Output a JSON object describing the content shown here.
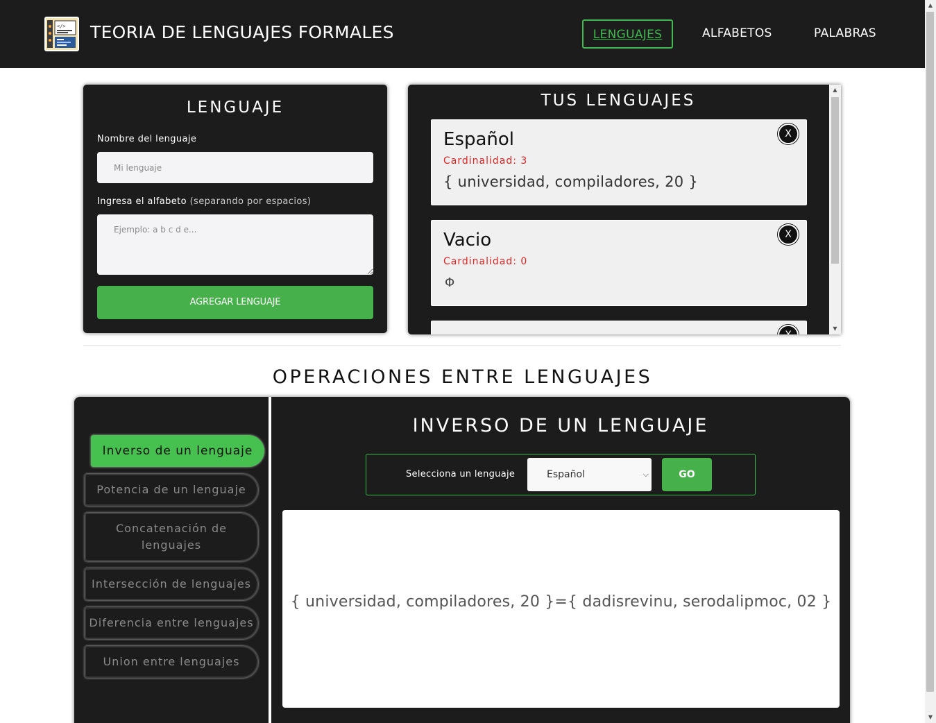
{
  "app": {
    "title": "TEORIA DE LENGUAJES FORMALES",
    "logo_icon": "code-window-icon"
  },
  "nav": {
    "items": [
      {
        "label": "LENGUAJES",
        "active": true
      },
      {
        "label": "ALFABETOS",
        "active": false
      },
      {
        "label": "PALABRAS",
        "active": false
      }
    ]
  },
  "form": {
    "title": "LENGUAJE",
    "name_label": "Nombre del lenguaje",
    "name_placeholder": "Mi lenguaje",
    "name_value": "",
    "alphabet_label": "Ingresa el alfabeto",
    "alphabet_hint": "(separando por espacios)",
    "alphabet_placeholder": "Ejemplo: a b c d e...",
    "alphabet_value": "",
    "submit_label": "AGREGAR LENGUAJE"
  },
  "list": {
    "title": "TUS LENGUAJES",
    "close_label": "X",
    "languages": [
      {
        "name": "Español",
        "cardinality": "Cardinalidad: 3",
        "set": "{ universidad, compiladores, 20 }"
      },
      {
        "name": "Vacio",
        "cardinality": "Cardinalidad: 0",
        "set": "Φ"
      },
      {
        "name": "",
        "cardinality": "",
        "set": ""
      }
    ]
  },
  "operations": {
    "section_title": "OPERACIONES ENTRE LENGUAJES",
    "items": [
      {
        "label": "Inverso de un lenguaje",
        "active": true
      },
      {
        "label": "Potencia de un lenguaje",
        "active": false
      },
      {
        "label": "Concatenación de lenguajes",
        "active": false
      },
      {
        "label": "Intersección de lenguajes",
        "active": false
      },
      {
        "label": "Diferencia entre lenguajes",
        "active": false
      },
      {
        "label": "Union entre lenguajes",
        "active": false
      }
    ],
    "current": {
      "title": "INVERSO DE UN LENGUAJE",
      "select_label": "Selecciona un lenguaje",
      "selected_language": "Español",
      "go_label": "GO",
      "result": "{ universidad, compiladores, 20 }={ dadisrevinu, serodalipmoc, 02 }"
    }
  },
  "colors": {
    "dark_bg": "#1c1c1c",
    "accent_green": "#46b04a",
    "active_nav_green": "#3fb950",
    "cardinality_red": "#e02424"
  }
}
